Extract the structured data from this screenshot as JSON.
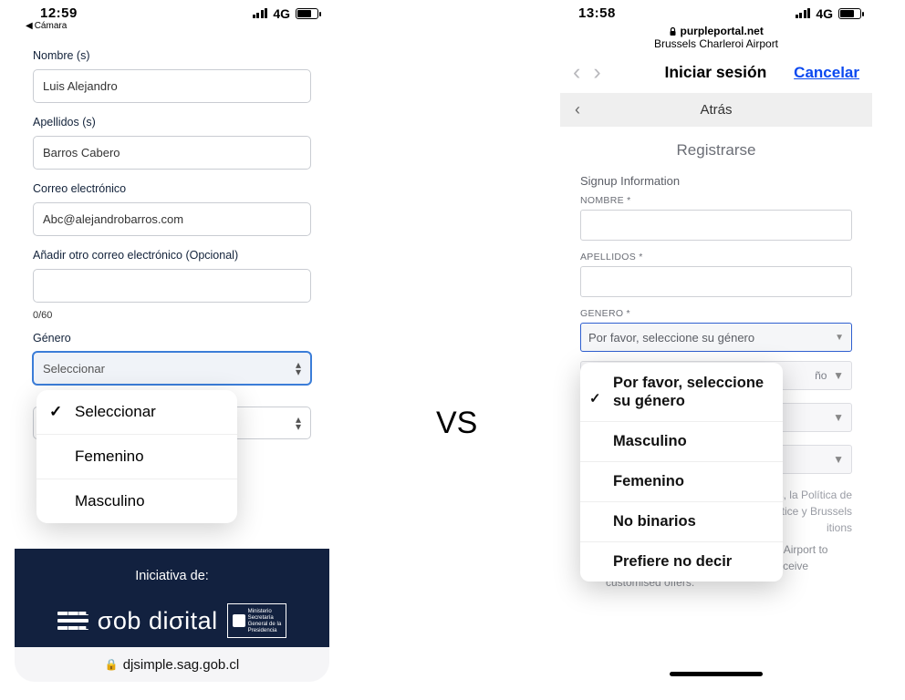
{
  "vs_label": "VS",
  "left": {
    "status": {
      "time": "12:59",
      "back_app": "Cámara",
      "net": "4G"
    },
    "form": {
      "name_label": "Nombre (s)",
      "name_value": "Luis Alejandro",
      "surname_label": "Apellidos (s)",
      "surname_value": "Barros Cabero",
      "email_label": "Correo electrónico",
      "email_value": "Abc@alejandrobarros.com",
      "alt_email_label": "Añadir otro correo electrónico (Opcional)",
      "alt_email_value": "",
      "char_count": "0/60",
      "gender_label": "Género",
      "gender_selected": "Seleccionar",
      "second_select_value": ""
    },
    "dropdown": {
      "opt1": "Seleccionar",
      "opt2": "Femenino",
      "opt3": "Masculino"
    },
    "footer": {
      "initiative": "Iniciativa de:",
      "logo_text": "σob diσital",
      "ministry_l1": "Ministerio",
      "ministry_l2": "Secretaría",
      "ministry_l3": "General de la",
      "ministry_l4": "Presidencia",
      "url": "djsimple.sag.gob.cl"
    }
  },
  "right": {
    "status": {
      "time": "13:58",
      "net": "4G"
    },
    "caption": {
      "host": "purpleportal.net",
      "sub": "Brussels Charleroi Airport"
    },
    "nav": {
      "title": "Iniciar sesión",
      "cancel": "Cancelar"
    },
    "back": "Atrás",
    "body": {
      "title": "Registrarse",
      "section": "Signup Information",
      "name_label": "NOMBRE *",
      "surname_label": "APELLIDOS *",
      "gender_label": "GENERO *",
      "gender_placeholder": "Por favor, seleccione su género",
      "visible_year_frag": "ño"
    },
    "dropdown": {
      "opt1": "Por favor, seleccione su género",
      "opt2": "Masculino",
      "opt3": "Femenino",
      "opt4": "No binarios",
      "opt5": "Prefiere no decir"
    },
    "below": {
      "frag1": "s, la Política de",
      "frag2": "otice y Brussels",
      "frag3": "itions",
      "consent_full": "I authorise Brussels South Charleroi Airport to share my data with third parties to receive customised offers."
    }
  }
}
